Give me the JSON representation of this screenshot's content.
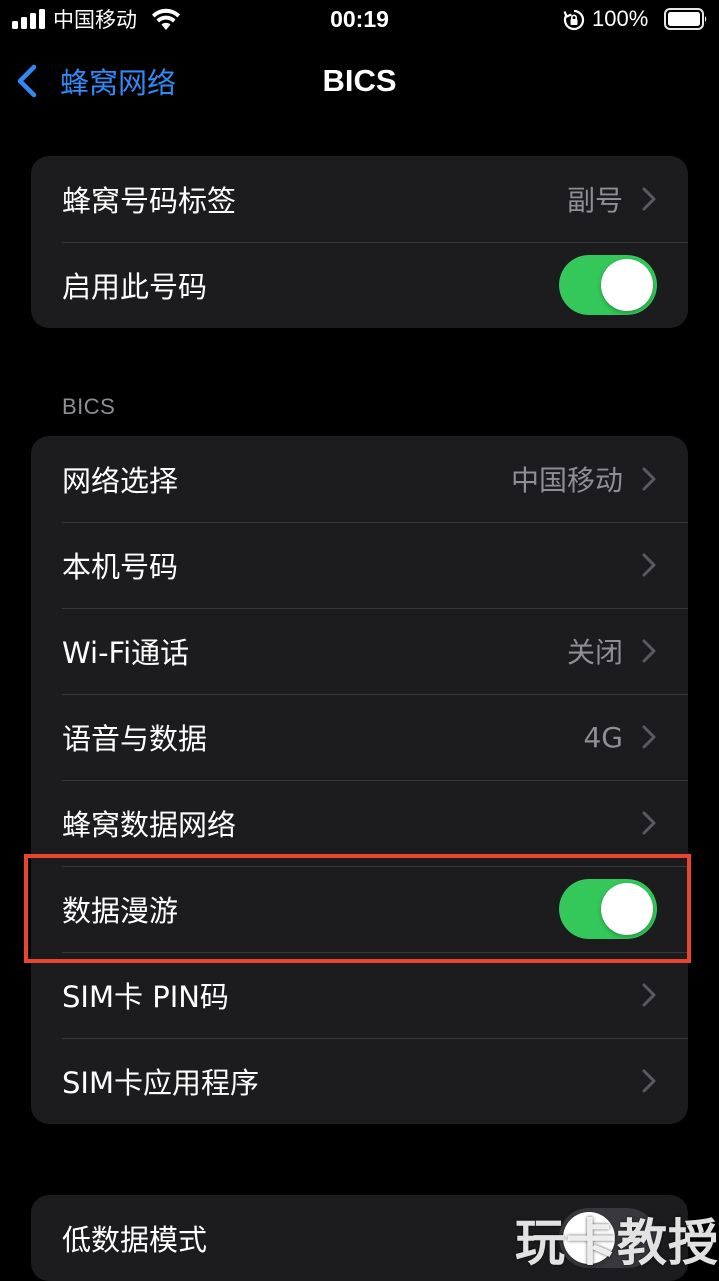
{
  "status_bar": {
    "carrier": "中国移动",
    "time": "00:19",
    "battery_percent": "100%",
    "icons": [
      "signal-bars-icon",
      "wifi-icon",
      "rotation-lock-icon",
      "battery-icon"
    ]
  },
  "nav": {
    "back_label": "蜂窝网络",
    "title": "BICS"
  },
  "group1": {
    "rows": [
      {
        "label": "蜂窝号码标签",
        "value": "副号"
      },
      {
        "label": "启用此号码",
        "toggle": "on"
      }
    ]
  },
  "section_header": "BICS",
  "group2": {
    "rows": [
      {
        "label": "网络选择",
        "value": "中国移动"
      },
      {
        "label": "本机号码",
        "value": ""
      },
      {
        "label": "Wi-Fi通话",
        "value": "关闭"
      },
      {
        "label": "语音与数据",
        "value": "4G"
      },
      {
        "label": "蜂窝数据网络",
        "value": ""
      },
      {
        "label": "数据漫游",
        "toggle": "on"
      },
      {
        "label": "SIM卡 PIN码",
        "value": ""
      },
      {
        "label": "SIM卡应用程序",
        "value": ""
      }
    ]
  },
  "group3": {
    "rows": [
      {
        "label": "低数据模式",
        "toggle": "off"
      }
    ]
  },
  "watermark": "玩卡教授",
  "colors": {
    "background": "#000000",
    "group_bg": "#1C1C1E",
    "accent_blue": "#2F8AF5",
    "toggle_on": "#34C759",
    "secondary_text": "#8E8E93",
    "highlight_border": "#E8442E"
  }
}
